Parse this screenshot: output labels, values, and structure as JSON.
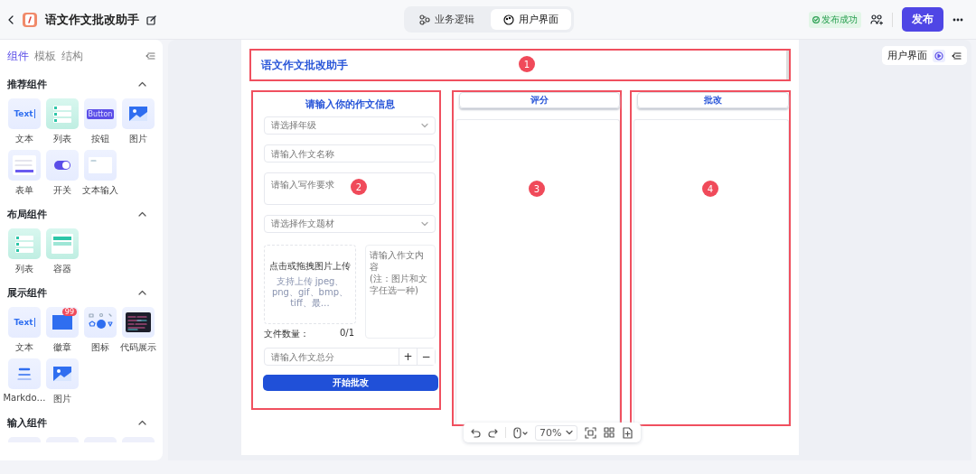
{
  "app": {
    "title": "语文作文批改助手"
  },
  "mode_tabs": [
    {
      "label": "业务逻辑",
      "selected": false
    },
    {
      "label": "用户界面",
      "selected": true
    }
  ],
  "publish_status": "发布成功",
  "publish_button": "发布",
  "sidebar": {
    "tabs": [
      {
        "label": "组件",
        "selected": true
      },
      {
        "label": "模板",
        "selected": false
      },
      {
        "label": "结构",
        "selected": false
      }
    ],
    "groups": [
      {
        "title": "推荐组件",
        "expanded": true,
        "items": [
          {
            "label": "文本",
            "kind": "text",
            "thumb_text": "Text"
          },
          {
            "label": "列表",
            "kind": "list"
          },
          {
            "label": "按钮",
            "kind": "button",
            "thumb_text": "Button"
          },
          {
            "label": "图片",
            "kind": "image"
          },
          {
            "label": "表单",
            "kind": "form"
          },
          {
            "label": "开关",
            "kind": "switch"
          },
          {
            "label": "文本输入",
            "kind": "textinput"
          }
        ]
      },
      {
        "title": "布局组件",
        "expanded": true,
        "items": [
          {
            "label": "列表",
            "kind": "list"
          },
          {
            "label": "容器",
            "kind": "container"
          }
        ]
      },
      {
        "title": "展示组件",
        "expanded": true,
        "items": [
          {
            "label": "文本",
            "kind": "text",
            "thumb_text": "Text"
          },
          {
            "label": "徽章",
            "kind": "badge",
            "thumb_text": "99"
          },
          {
            "label": "图标",
            "kind": "icons"
          },
          {
            "label": "代码展示",
            "kind": "code"
          },
          {
            "label": "Markdo…",
            "kind": "markdown"
          },
          {
            "label": "图片",
            "kind": "image"
          }
        ]
      },
      {
        "title": "输入组件",
        "expanded": true,
        "items": [
          {
            "kind": "partial"
          },
          {
            "kind": "partial"
          },
          {
            "kind": "partial"
          },
          {
            "kind": "partial"
          }
        ]
      }
    ]
  },
  "canvas": {
    "view_label": "用户界面",
    "zoom": "70%"
  },
  "preview": {
    "header": {
      "title": "语文作文批改助手",
      "marker": "1"
    },
    "form": {
      "title": "请输入你的作文信息",
      "marker": "2",
      "fields": [
        {
          "kind": "select",
          "placeholder": "请选择年级"
        },
        {
          "kind": "input",
          "placeholder": "请输入作文名称"
        },
        {
          "kind": "textarea",
          "placeholder": "请输入写作要求"
        },
        {
          "kind": "select",
          "placeholder": "请选择作文题材"
        }
      ],
      "upload": {
        "title": "点击或拖拽图片上传",
        "hint": "支持上传 jpeg、png、gif、bmp、tiff、最…",
        "count_label": "文件数量：",
        "count": "0/1"
      },
      "content_placeholder": "请输入作文内容\n(注：图片和文字任选一种)",
      "score": {
        "placeholder": "请输入作文总分",
        "plus": "+",
        "minus": "−"
      },
      "submit": "开始批改"
    },
    "panels": [
      {
        "title": "评分",
        "marker": "3"
      },
      {
        "title": "批改",
        "marker": "4"
      }
    ]
  }
}
